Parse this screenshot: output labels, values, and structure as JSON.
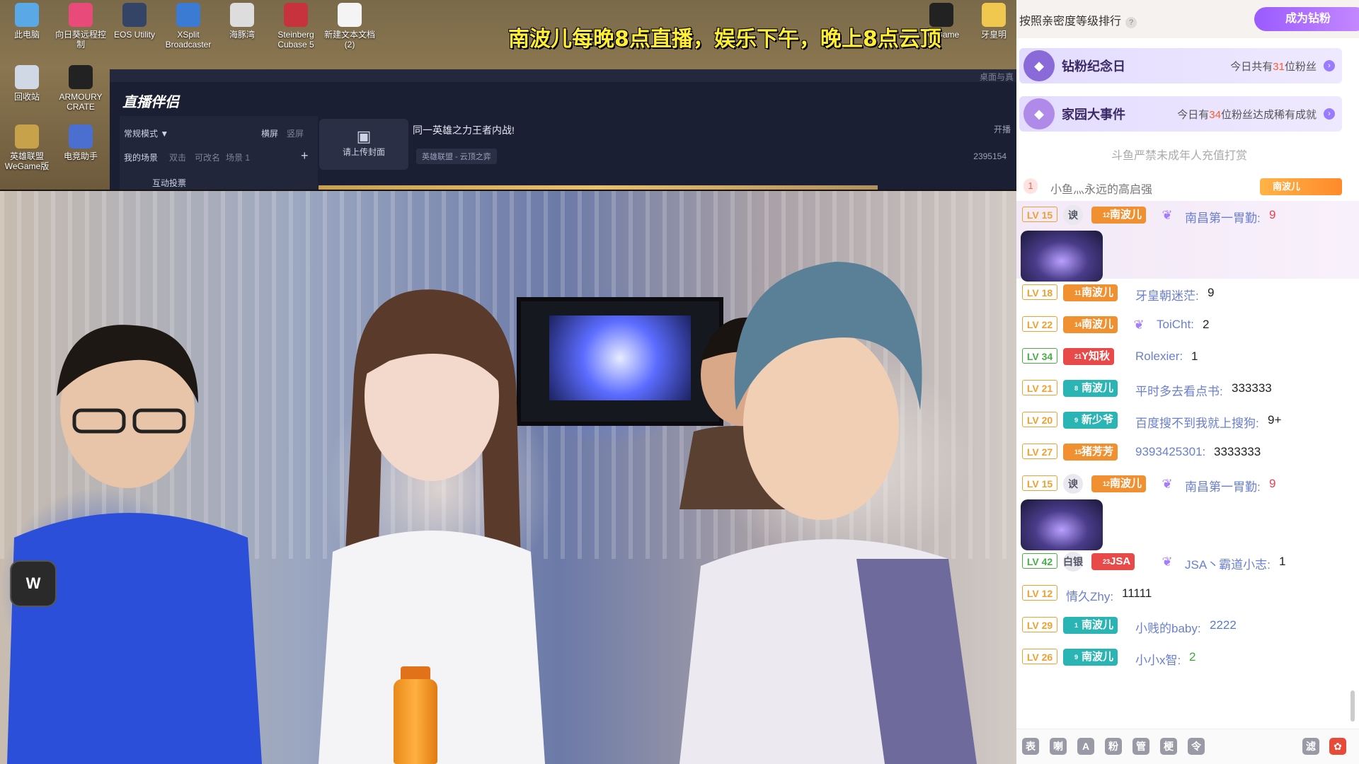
{
  "desktop": {
    "icons": [
      {
        "label": "此电脑",
        "icon": "computer-icon",
        "color": "#5aa9e6"
      },
      {
        "label": "向日葵远程控制",
        "icon": "sunflower-icon",
        "color": "#e84a7a"
      },
      {
        "label": "EOS Utility",
        "icon": "camera-icon",
        "color": "#334466"
      },
      {
        "label": "XSplit Broadcaster",
        "icon": "xsplit-icon",
        "color": "#3b7bd4"
      },
      {
        "label": "海豚湾",
        "icon": "dolphin-icon",
        "color": "#dddddd"
      },
      {
        "label": "Steinberg Cubase 5",
        "icon": "cubase-icon",
        "color": "#c8323c"
      },
      {
        "label": "新建文本文档 (2)",
        "icon": "text-file-icon",
        "color": "#f4f4f4"
      },
      {
        "label": "回收站",
        "icon": "recycle-bin-icon",
        "color": "#d0d8e6"
      },
      {
        "label": "ARMOURY CRATE",
        "icon": "armoury-crate-icon",
        "color": "#222222"
      },
      {
        "label": "英雄联盟WeGame版",
        "icon": "lol-icon",
        "color": "#c8a24a"
      },
      {
        "label": "电竞助手",
        "icon": "esports-helper-icon",
        "color": "#4a6fd0"
      },
      {
        "label": "WeGame",
        "icon": "wegame-icon",
        "color": "#222222"
      },
      {
        "label": "牙皇明",
        "icon": "folder-icon",
        "color": "#f0c850"
      }
    ],
    "banner": "南波儿每晚8点直播，娱乐下午，晚上8点云顶"
  },
  "companion": {
    "logo": "直播伴侣",
    "mode": "常规模式 ▼",
    "orient_h": "横屏",
    "orient_v": "竖屏",
    "tabs": [
      "我的场景",
      "双击",
      "可改名",
      "场景 1"
    ],
    "add": "+",
    "scene_item": "互动投票",
    "upload": "请上传封面",
    "title": "同一英雄之力王者内战!",
    "category": "英雄联盟 - 云顶之弈",
    "count": "2395154",
    "live": "开播",
    "topbar": "桌面与真"
  },
  "chat": {
    "rank_title": "按照亲密度等级排行",
    "vip_button": "成为钻粉",
    "cards": [
      {
        "title": "钻粉纪念日",
        "sub_pre": "今日共有",
        "sub_num": "31",
        "sub_post": "位粉丝",
        "emblem_color": "#8a6ad8"
      },
      {
        "title": "家园大事件",
        "sub_pre": "今日有",
        "sub_num": "34",
        "sub_post": "位粉丝达成稀有成就",
        "emblem_color": "#b08ae8"
      }
    ],
    "notice": "斗鱼严禁未成年人充值打赏",
    "rank1": {
      "num": "1",
      "name": "小鱼灬永远的高启强",
      "badge": "南波儿",
      "badge_lv": "50"
    },
    "messages": [
      {
        "lv": "LV 15",
        "lv_color": "#f0a030",
        "prefix": "谀",
        "badge": "南波儿",
        "badge_lv": "12",
        "badge_color": "#f09030",
        "wings": true,
        "name": "南昌第一胃勤:",
        "msg": "9",
        "msg_style": "red",
        "sticker": true,
        "highlight": true
      },
      {
        "lv": "LV 18",
        "lv_color": "#f0a030",
        "badge": "南波儿",
        "badge_lv": "11",
        "badge_color": "#f09030",
        "name": "牙皇朝迷茫:",
        "msg": "9"
      },
      {
        "lv": "LV 22",
        "lv_color": "#f0a030",
        "badge": "南波儿",
        "badge_lv": "14",
        "badge_color": "#f09030",
        "wings": true,
        "name": "ToiCht:",
        "msg": "2"
      },
      {
        "lv": "LV 34",
        "lv_color": "#46b046",
        "badge": "Y知秋",
        "badge_lv": "21",
        "badge_color": "#e84a4a",
        "name": "Rolexier:",
        "msg": "1"
      },
      {
        "lv": "LV 21",
        "lv_color": "#f0a030",
        "badge": "南波儿",
        "badge_lv": "8",
        "badge_color": "#2ab4b4",
        "name": "平时多去看点书:",
        "msg": "333333"
      },
      {
        "lv": "LV 20",
        "lv_color": "#f0a030",
        "badge": "新少爷",
        "badge_lv": "9",
        "badge_color": "#2ab4b4",
        "name": "百度搜不到我就上搜狗:",
        "msg": "9+"
      },
      {
        "lv": "LV 27",
        "lv_color": "#f0a030",
        "badge": "猪芳芳",
        "badge_lv": "15",
        "badge_color": "#f09030",
        "name": "9393425301:",
        "msg": "3333333"
      },
      {
        "lv": "LV 15",
        "lv_color": "#f0a030",
        "prefix": "谀",
        "badge": "南波儿",
        "badge_lv": "12",
        "badge_color": "#f09030",
        "wings": true,
        "name": "南昌第一胃勤:",
        "msg": "9",
        "msg_style": "red",
        "sticker": true
      },
      {
        "lv": "LV 42",
        "lv_color": "#46b046",
        "prefix": "白银",
        "badge": "JSA",
        "badge_lv": "23",
        "badge_color": "#e84a4a",
        "wings": true,
        "name": "JSA丶霸道小志:",
        "msg": "1"
      },
      {
        "lv": "LV 12",
        "lv_color": "#f0a030",
        "name": "情久Zhy:",
        "msg": "11111"
      },
      {
        "lv": "LV 29",
        "lv_color": "#f0a030",
        "badge": "南波儿",
        "badge_lv": "1",
        "badge_color": "#2ab4b4",
        "name": "小贱的baby:",
        "msg": "2222",
        "msg_style": "blue"
      },
      {
        "lv": "LV 26",
        "lv_color": "#f0a030",
        "badge": "南波儿",
        "badge_lv": "9",
        "badge_color": "#2ab4b4",
        "name": "小小x智:",
        "msg": "2",
        "msg_style": "green"
      }
    ],
    "tools": [
      "表",
      "喇",
      "A",
      "粉",
      "管",
      "梗",
      "令"
    ],
    "tool_right": "滤",
    "gift": "✿"
  }
}
